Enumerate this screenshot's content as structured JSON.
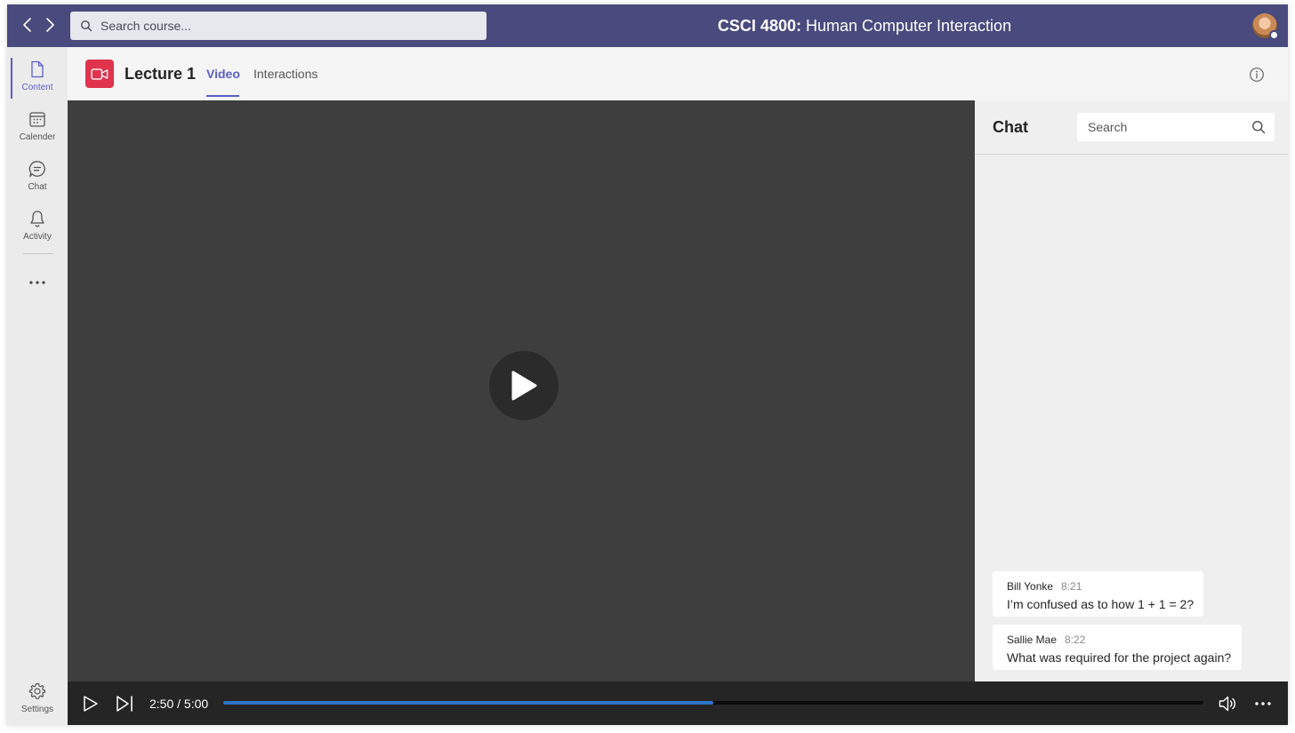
{
  "topbar": {
    "search_placeholder": "Search course...",
    "course_code": "CSCI 4800:",
    "course_name": " Human Computer Interaction"
  },
  "rail": {
    "items": [
      {
        "label": "Content",
        "icon": "document-icon"
      },
      {
        "label": "Calender",
        "icon": "calendar-icon"
      },
      {
        "label": "Chat",
        "icon": "chat-icon"
      },
      {
        "label": "Activity",
        "icon": "bell-icon"
      }
    ],
    "settings_label": "Settings"
  },
  "header": {
    "title": "Lecture 1",
    "tabs": [
      {
        "label": "Video",
        "active": true
      },
      {
        "label": "Interactions",
        "active": false
      }
    ]
  },
  "chat": {
    "title": "Chat",
    "search_placeholder": "Search",
    "messages": [
      {
        "author": "Bill Yonke",
        "time": "8:21",
        "text": "I’m confused as to how 1 + 1 = 2?"
      },
      {
        "author": "Sallie Mae",
        "time": "8:22",
        "text": "What was required for the project again?"
      }
    ]
  },
  "player": {
    "timecode": "2:50 / 5:00",
    "progress": 0.5
  },
  "colors": {
    "topbar": "#494a7d",
    "accent": "#5b5fc7",
    "lecture_icon": "#e0334d",
    "progress": "#2e74c9"
  }
}
